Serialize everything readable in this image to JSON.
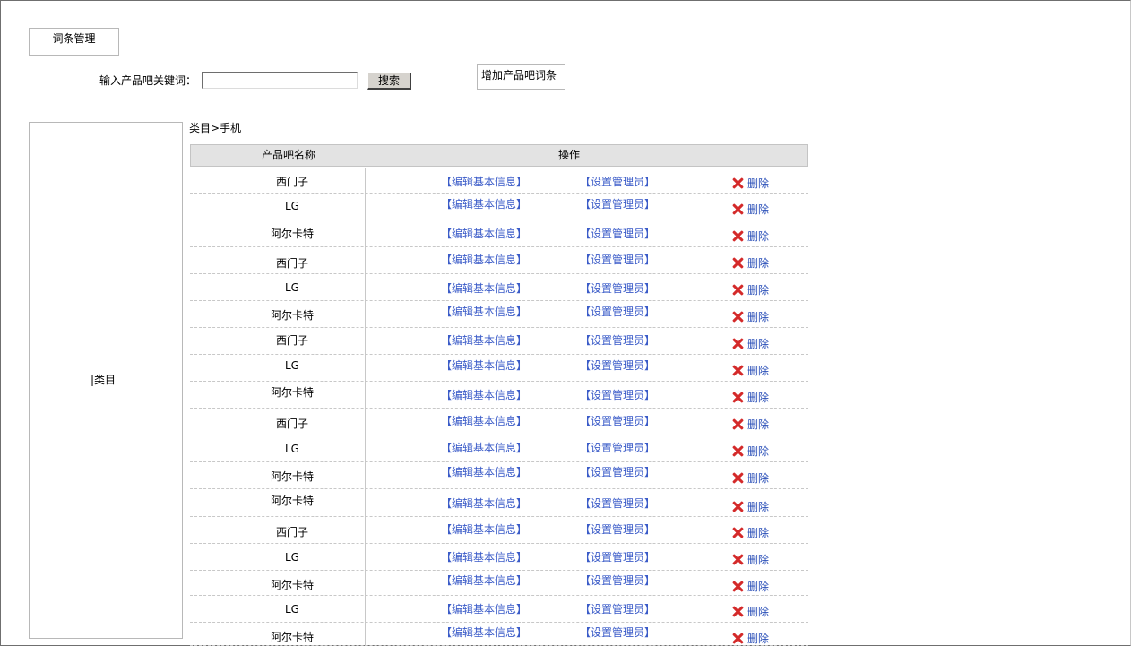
{
  "header": {
    "tab_label": "词条管理",
    "search_label": "输入产品吧关键词：",
    "search_value": "",
    "search_button": "搜索",
    "add_button": "增加产品吧词条"
  },
  "sidebar": {
    "label": "|类目"
  },
  "breadcrumb": "类目>手机",
  "table": {
    "columns": [
      "产品吧名称",
      "操作"
    ],
    "action_labels": {
      "edit": "【编辑基本信息】",
      "admin": "【设置管理员】",
      "delete": "删除"
    },
    "rows": [
      "西门子",
      "LG",
      "阿尔卡特",
      "西门子",
      "LG",
      "阿尔卡特",
      "西门子",
      "LG",
      "阿尔卡特",
      "西门子",
      "LG",
      "阿尔卡特",
      "阿尔卡特",
      "西门子",
      "LG",
      "阿尔卡特",
      "LG",
      "阿尔卡特"
    ]
  },
  "colors": {
    "link": "#3a5bc8",
    "delete_icon": "#d42a2a",
    "header_bg": "#e3e3e3"
  },
  "icons": {
    "delete": "close-icon"
  }
}
